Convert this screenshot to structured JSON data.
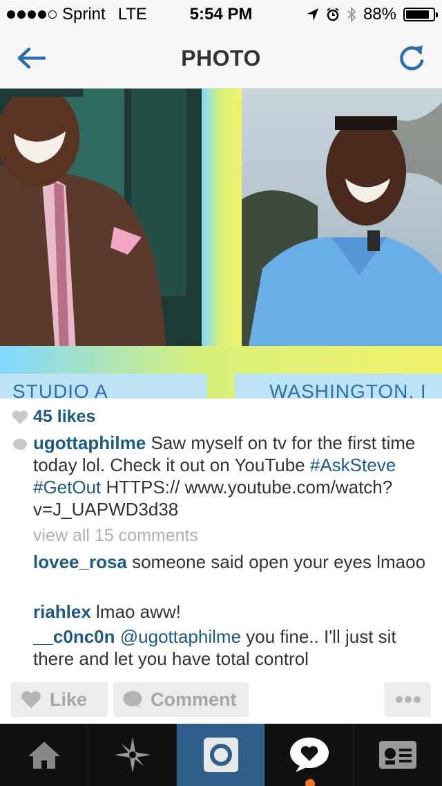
{
  "status_bar": {
    "carrier": "Sprint",
    "network": "LTE",
    "time": "5:54 PM",
    "battery": "88%",
    "battery_level": 0.88,
    "signal_bars": 4
  },
  "nav": {
    "title": "PHOTO",
    "back_icon": "back-arrow-icon",
    "refresh_icon": "refresh-icon"
  },
  "photo": {
    "left_label": "STUDIO A",
    "right_label": "WASHINGTON, I"
  },
  "post": {
    "likes": "45 likes",
    "caption": {
      "username": "ugottaphilme",
      "text1": " Saw myself on tv for the first time today lol. Check it out on YouTube ",
      "tag1": "#AskSteve",
      "tag2": "#GetOut",
      "text2": " HTTPS:// www.youtube.com/watch?v=J_UAPWD3d38"
    },
    "view_all": "view all 15 comments",
    "comments": [
      {
        "user": "lovee_rosa",
        "text": " someone said open your eyes lmaoo"
      },
      {
        "user": "riahlex",
        "text": " lmao aww!"
      },
      {
        "user": "__c0nc0n",
        "mention": " @ugottaphilme",
        "text": " you fine.. I'll just sit there and let you have total control"
      }
    ]
  },
  "actions": {
    "like": "Like",
    "comment": "Comment",
    "more_icon": "more-dots-icon"
  },
  "tabbar": {
    "tabs": [
      "home-icon",
      "explore-icon",
      "camera-icon",
      "activity-icon",
      "profile-icon"
    ]
  },
  "colors": {
    "link": "#1c5a8a",
    "accent_icon": "#2b6cb0",
    "tab_active": "#2e5f8a",
    "notify": "#f37421"
  }
}
